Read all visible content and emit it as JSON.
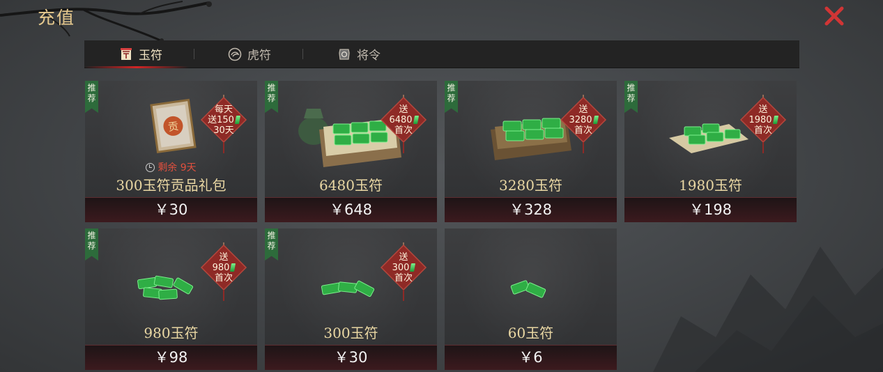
{
  "header": {
    "title": "充值"
  },
  "tabs": [
    {
      "label": "玉符",
      "icon": "jade-token-icon",
      "active": true
    },
    {
      "label": "虎符",
      "icon": "tiger-token-icon",
      "active": false
    },
    {
      "label": "将令",
      "icon": "general-order-icon",
      "active": false
    }
  ],
  "products": [
    {
      "tag": "推荐",
      "badge_lines": [
        "每天",
        "送150",
        "30天"
      ],
      "name": "300玉符贡品礼包",
      "price": "￥30",
      "timer_label": "剩余 9天",
      "image": "tribute-gift-pack"
    },
    {
      "tag": "推荐",
      "badge_lines": [
        "送",
        "6480",
        "首次"
      ],
      "name": "6480玉符",
      "price": "￥648",
      "image": "jade-chest-with-bag"
    },
    {
      "tag": "推荐",
      "badge_lines": [
        "送",
        "3280",
        "首次"
      ],
      "name": "3280玉符",
      "price": "￥328",
      "image": "jade-tray"
    },
    {
      "tag": "推荐",
      "badge_lines": [
        "送",
        "1980",
        "首次"
      ],
      "name": "1980玉符",
      "price": "￥198",
      "image": "jade-cloth-bundle"
    },
    {
      "tag": "推荐",
      "badge_lines": [
        "送",
        "980",
        "首次"
      ],
      "name": "980玉符",
      "price": "￥98",
      "image": "jade-pile-large"
    },
    {
      "tag": "推荐",
      "badge_lines": [
        "送",
        "300",
        "首次"
      ],
      "name": "300玉符",
      "price": "￥30",
      "image": "jade-pile-medium"
    },
    {
      "name": "60玉符",
      "price": "￥6",
      "image": "jade-pile-small"
    }
  ],
  "colors": {
    "accent_red": "#d12525",
    "gold_text": "#e9d7a3",
    "badge_red": "#8e2a26",
    "tag_green": "#2d6b3b",
    "jade_green": "#3fcf55"
  }
}
